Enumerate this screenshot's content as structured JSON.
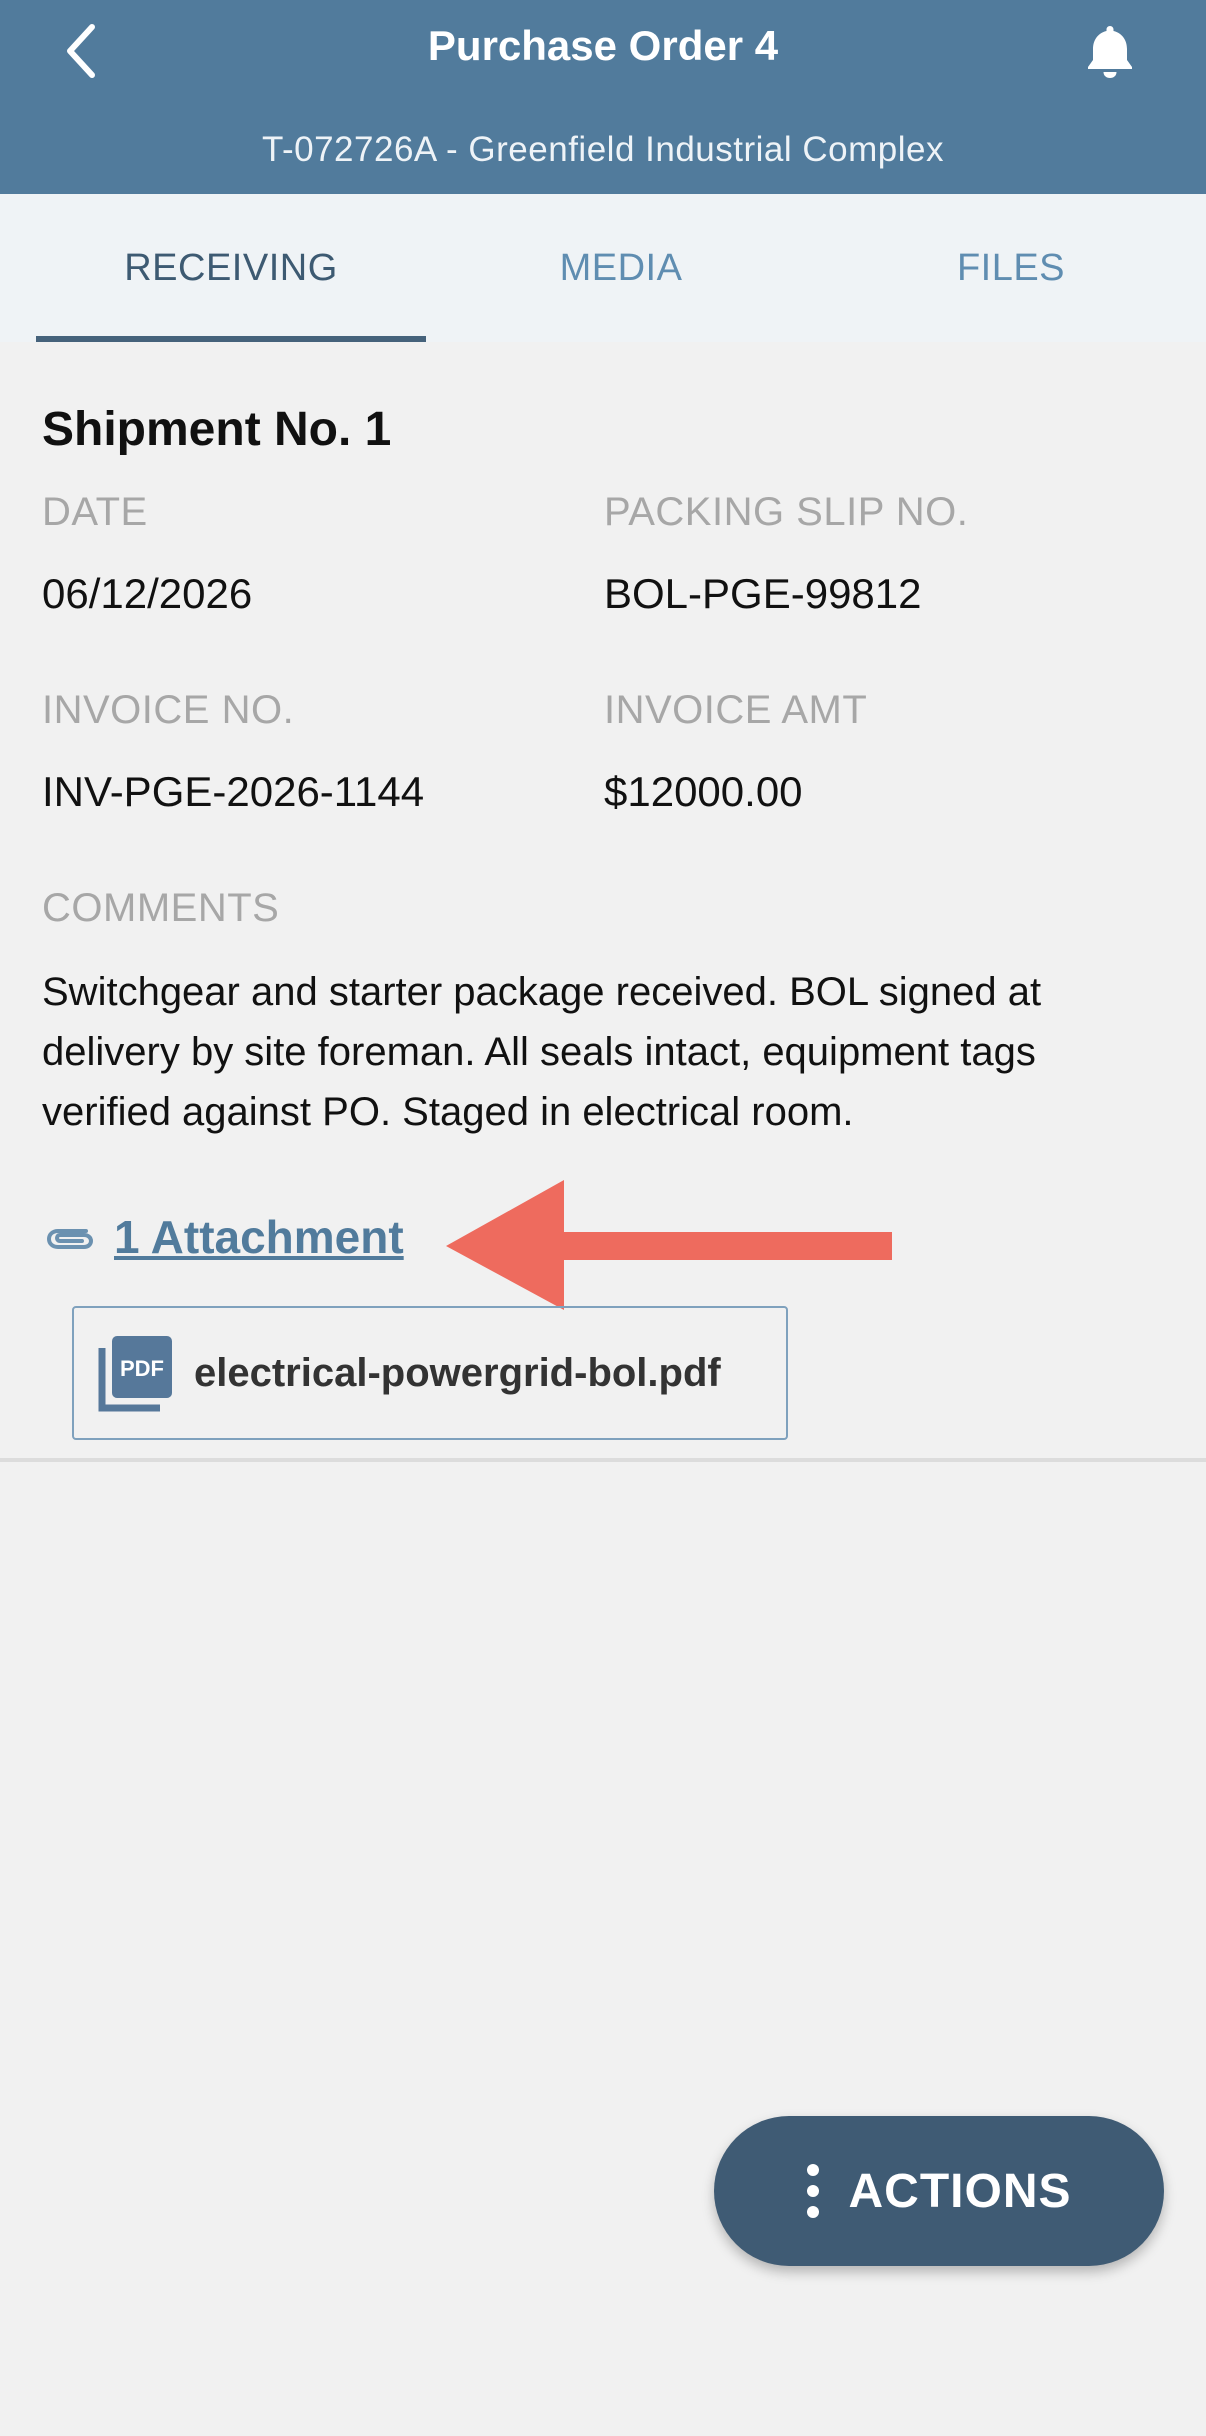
{
  "header": {
    "title": "Purchase Order 4",
    "subtitle": "T-072726A - Greenfield Industrial Complex",
    "background_color": "#517b9c"
  },
  "icons": {
    "back": "chevron-left-icon",
    "notifications": "bell-icon",
    "attachment": "paperclip-icon",
    "file": "pdf-icon",
    "menu": "kebab-icon",
    "annotation": "arrow-left-icon"
  },
  "tabs": [
    {
      "label": "RECEIVING",
      "active": true
    },
    {
      "label": "MEDIA",
      "active": false
    },
    {
      "label": "FILES",
      "active": false
    }
  ],
  "shipment": {
    "title": "Shipment No. 1",
    "date_label": "DATE",
    "date_value": "06/12/2026",
    "packing_slip_label": "PACKING SLIP NO.",
    "packing_slip_value": "BOL-PGE-99812",
    "invoice_no_label": "INVOICE NO.",
    "invoice_no_value": "INV-PGE-2026-1144",
    "invoice_amt_label": "INVOICE AMT",
    "invoice_amt_value": "$12000.00",
    "comments_label": "COMMENTS",
    "comments_value": "Switchgear and starter package received. BOL signed at delivery by site foreman. All seals intact, equipment tags verified against PO. Staged in electrical room."
  },
  "attachments": {
    "link_label": "1 Attachment",
    "files": [
      {
        "name": "electrical-powergrid-bol.pdf",
        "icon_text": "PDF"
      }
    ]
  },
  "actions": {
    "label": "ACTIONS"
  },
  "colors": {
    "accent": "#517b9c",
    "tab_active": "#3d5a72",
    "tab_inactive": "#5f8db1",
    "label_gray": "#a7a7a7",
    "annotation_red": "#ee6b5e",
    "fab": "#3f5b74"
  }
}
